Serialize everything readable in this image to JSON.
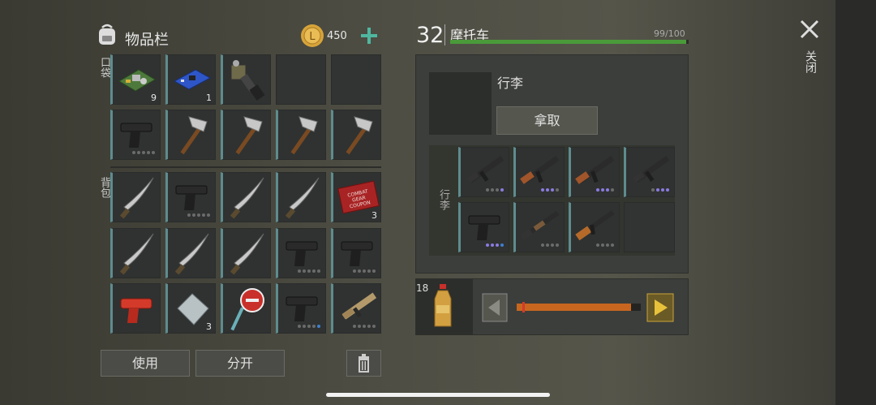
{
  "inventory": {
    "title": "物品栏",
    "coins": "450",
    "pocket_label": "口袋",
    "backpack_label": "背包",
    "pocket_slots": [
      {
        "icon": "circuit-board-icon",
        "count": "9"
      },
      {
        "icon": "chip-board-icon",
        "count": "1"
      },
      {
        "icon": "engine-part-icon",
        "count": ""
      },
      {
        "icon": "",
        "count": ""
      },
      {
        "icon": "",
        "count": ""
      },
      {
        "icon": "pistol-icon",
        "count": ""
      },
      {
        "icon": "hatchet-icon",
        "count": ""
      },
      {
        "icon": "hatchet-icon",
        "count": ""
      },
      {
        "icon": "hatchet-icon",
        "count": ""
      },
      {
        "icon": "hatchet-icon",
        "count": ""
      }
    ],
    "backpack_slots": [
      {
        "icon": "machete-icon",
        "count": ""
      },
      {
        "icon": "pistol-icon",
        "count": ""
      },
      {
        "icon": "machete-icon",
        "count": ""
      },
      {
        "icon": "machete-icon",
        "count": ""
      },
      {
        "icon": "coupon-icon",
        "count": "3",
        "text": "COMBAT GEAR COUPON"
      },
      {
        "icon": "machete-icon",
        "count": ""
      },
      {
        "icon": "machete-icon",
        "count": ""
      },
      {
        "icon": "machete-icon",
        "count": ""
      },
      {
        "icon": "pistol-icon",
        "count": ""
      },
      {
        "icon": "pistol-icon",
        "count": ""
      },
      {
        "icon": "flare-gun-icon",
        "count": ""
      },
      {
        "icon": "metal-plate-icon",
        "count": "3"
      },
      {
        "icon": "stop-sign-icon",
        "count": ""
      },
      {
        "icon": "pistol-icon",
        "count": ""
      },
      {
        "icon": "assault-rifle-tan-icon",
        "count": ""
      }
    ],
    "use_button": "使用",
    "split_button": "分开"
  },
  "vehicle": {
    "level": "32",
    "name": "摩托车",
    "durability_text": "99/100",
    "durability_fraction": 0.99,
    "storage_title": "行李",
    "take_button": "拿取",
    "cargo_label": "行李",
    "cargo_slots": [
      {
        "icon": "assault-rifle-icon"
      },
      {
        "icon": "ak-rifle-icon"
      },
      {
        "icon": "ak-rifle-icon"
      },
      {
        "icon": "assault-rifle-icon"
      },
      {
        "icon": "pistol-icon"
      },
      {
        "icon": "shotgun-icon"
      },
      {
        "icon": "carbine-icon"
      },
      {
        "icon": ""
      }
    ]
  },
  "fuel": {
    "count": "18",
    "level_fraction": 0.92
  },
  "close_label": "关闭",
  "colors": {
    "accent_green": "#4a9a3a",
    "teal_border": "#5e8c8e",
    "fuel_orange": "#c8661f",
    "coin_gold": "#d7a43a"
  }
}
